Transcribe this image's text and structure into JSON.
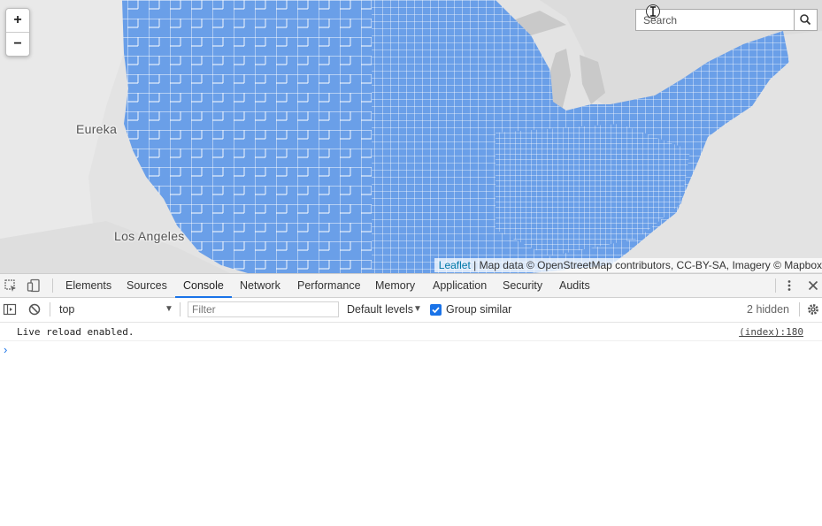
{
  "map": {
    "zoom_in": "+",
    "zoom_out": "−",
    "cities": {
      "eureka": "Eureka",
      "los_angeles": "Los Angeles"
    },
    "search": {
      "placeholder": "Search"
    },
    "attribution": {
      "leaflet": "Leaflet",
      "text": " | Map data © OpenStreetMap contributors, CC-BY-SA, Imagery © Mapbox"
    },
    "colors": {
      "region_fill": "#6a9fe8",
      "region_stroke": "#ffffff",
      "background": "#e2e2e2"
    }
  },
  "devtools": {
    "tabs": [
      "Elements",
      "Sources",
      "Console",
      "Network",
      "Performance",
      "Memory",
      "Application",
      "Security",
      "Audits"
    ],
    "active_tab": "Console",
    "context": "top",
    "filter_placeholder": "Filter",
    "levels": "Default levels",
    "group_similar": "Group similar",
    "group_similar_checked": true,
    "hidden_count": "2 hidden",
    "messages": [
      {
        "text": "Live reload enabled.",
        "source": "(index):180"
      }
    ],
    "prompt": "›"
  }
}
